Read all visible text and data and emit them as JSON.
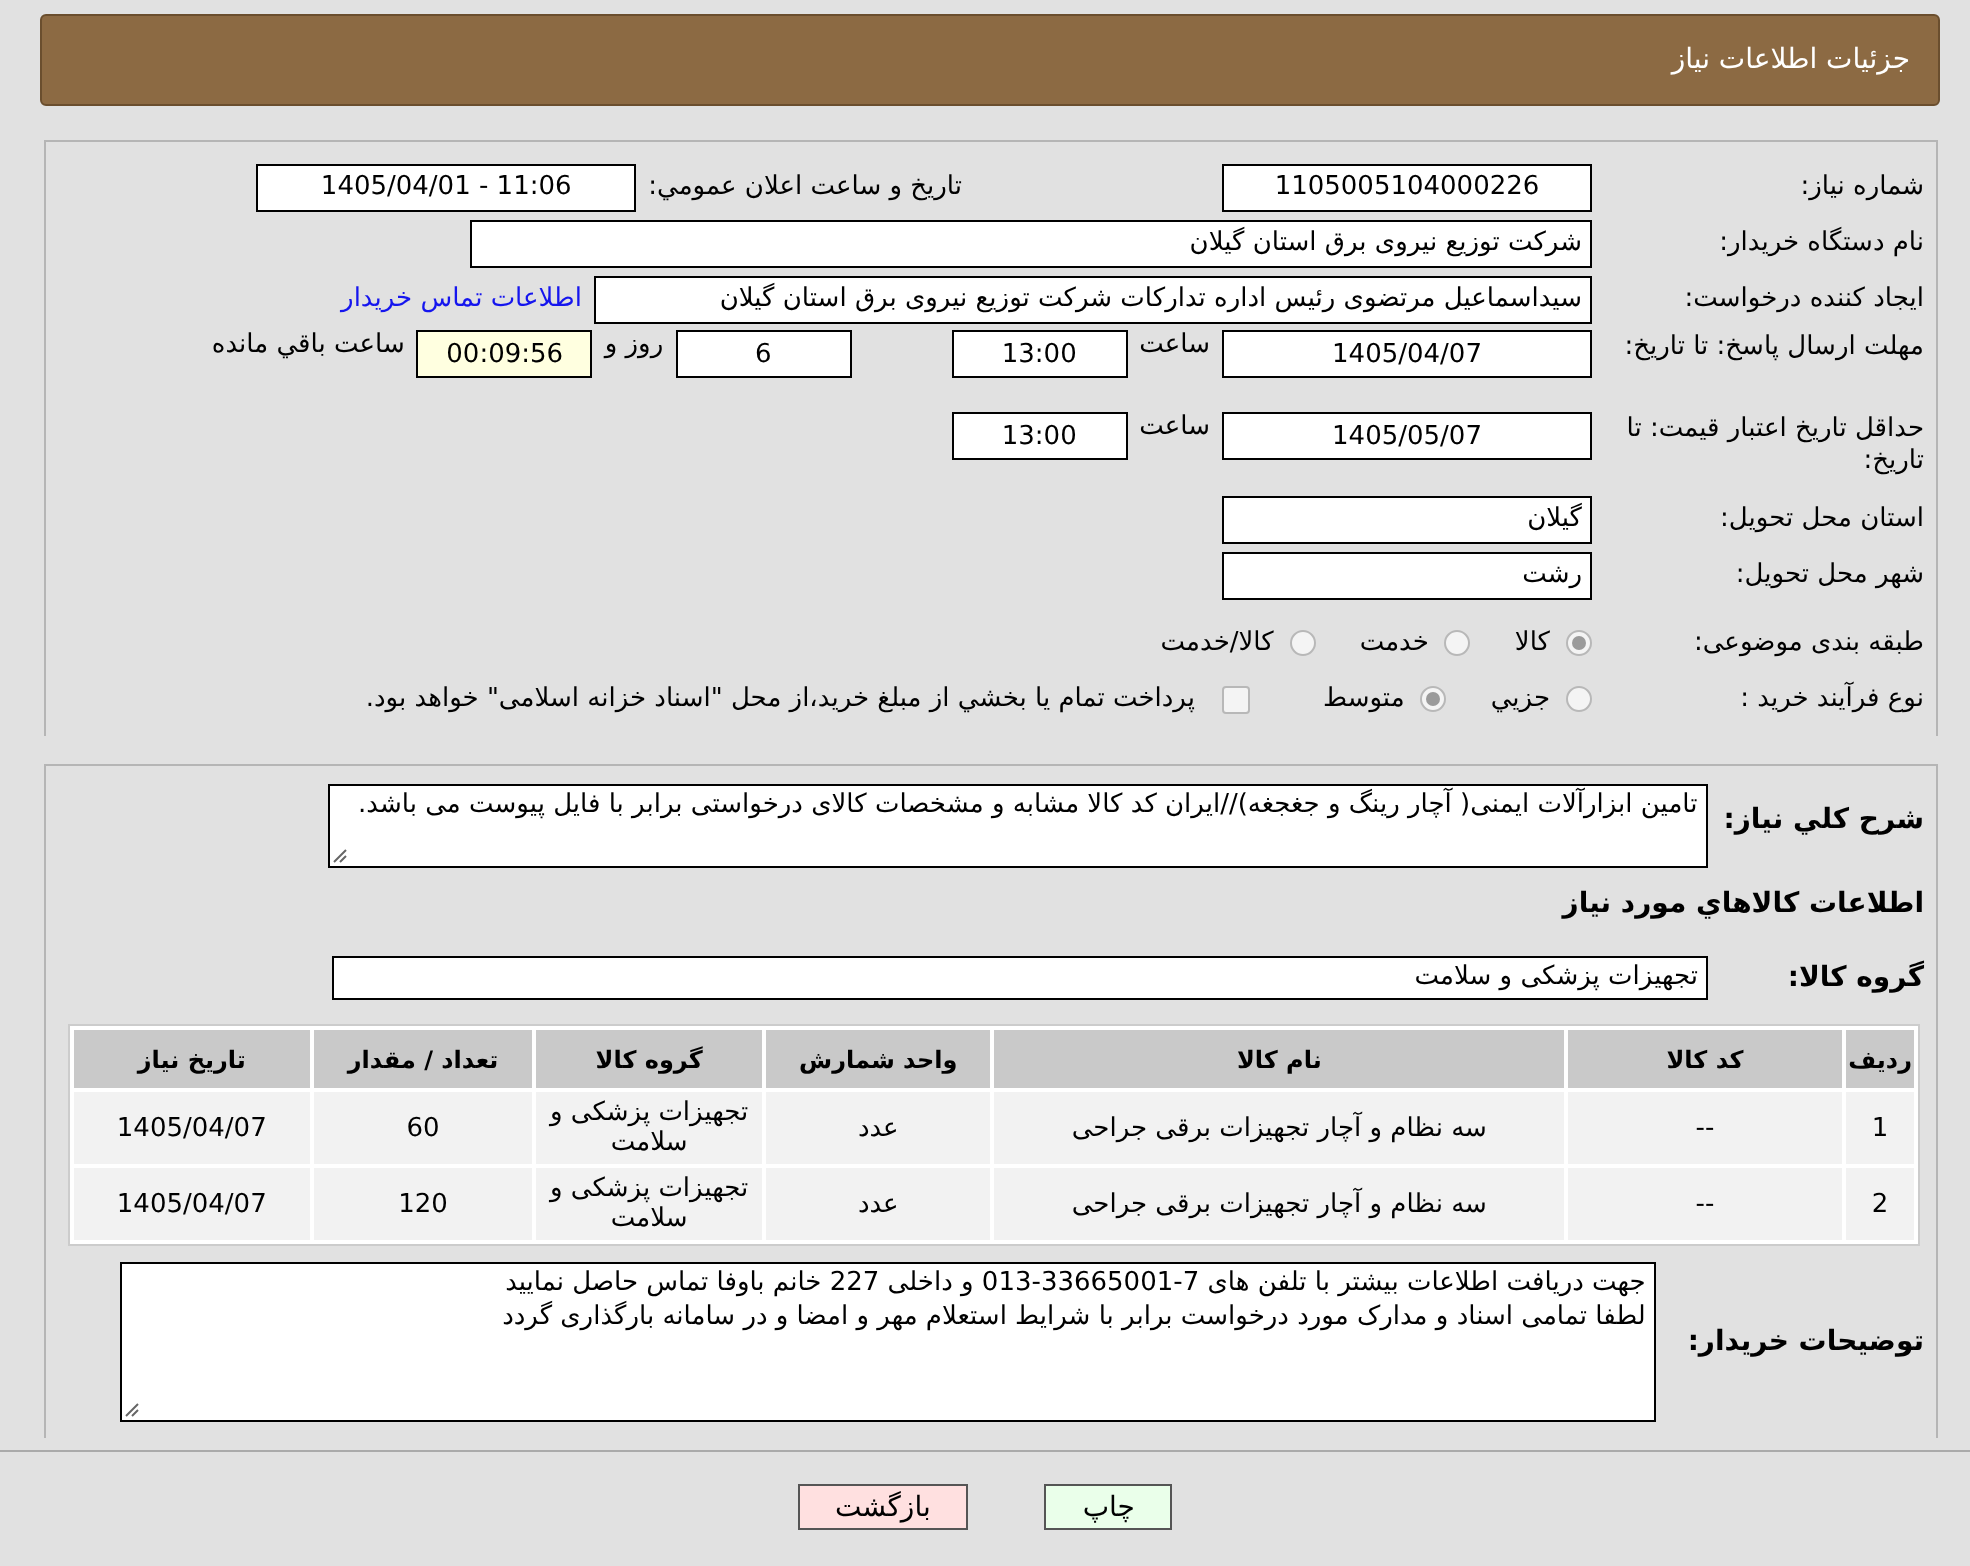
{
  "header": {
    "title": "جزئیات اطلاعات نیاز"
  },
  "details": {
    "need_number": {
      "label": "شماره نیاز:",
      "value": "1105005104000226"
    },
    "announce": {
      "label": "تاريخ و ساعت اعلان عمومي:",
      "value": "1405/04/01 - 11:06"
    },
    "buyer_org": {
      "label": "نام دستگاه خریدار:",
      "value": "شرکت توزیع نیروی برق استان گیلان"
    },
    "requester": {
      "label": "ایجاد کننده درخواست:",
      "value": "سیداسماعیل مرتضوی رئیس اداره تدارکات شرکت توزیع نیروی برق استان گیلان",
      "link": "اطلاعات تماس خريدار"
    },
    "reply_deadline": {
      "label": "مهلت ارسال پاسخ: تا تاریخ:",
      "date": "1405/04/07",
      "time_label": "ساعت",
      "time": "13:00",
      "days": "6",
      "days_label": "روز و",
      "remaining": "00:09:56",
      "remaining_label": "ساعت باقي مانده"
    },
    "price_validity": {
      "label": "حداقل تاریخ اعتبار قیمت: تا تاریخ:",
      "date": "1405/05/07",
      "time_label": "ساعت",
      "time": "13:00"
    },
    "province": {
      "label": "استان محل تحویل:",
      "value": "گیلان"
    },
    "city": {
      "label": "شهر محل تحویل:",
      "value": "رشت"
    },
    "category": {
      "label": "طبقه بندی موضوعی:",
      "options": [
        {
          "label": "کالا",
          "selected": true
        },
        {
          "label": "خدمت",
          "selected": false
        },
        {
          "label": "کالا/خدمت",
          "selected": false
        }
      ]
    },
    "process": {
      "label": "نوع فرآیند خرید :",
      "options": [
        {
          "label": "جزيي",
          "selected": false
        },
        {
          "label": "متوسط",
          "selected": true
        }
      ],
      "treasury": {
        "checked": false,
        "text": "پرداخت تمام يا بخشي از مبلغ خريد،از محل \"اسناد خزانه اسلامی\" خواهد بود."
      }
    }
  },
  "need": {
    "description": {
      "label": "شرح کلي نياز:",
      "value": "تامین ابزارآلات ایمنی( آچار رینگ و جغجغه)//ایران کد کالا مشابه و مشخصات کالای درخواستی برابر با فایل پیوست می باشد."
    },
    "goods_heading": "اطلاعات کالاهاي مورد نياز",
    "goods_group": {
      "label": "گروه کالا:",
      "value": "تجهیزات پزشکی و سلامت"
    },
    "table": {
      "columns": [
        "ردیف",
        "کد کالا",
        "نام کالا",
        "واحد شمارش",
        "گروه کالا",
        "تعداد / مقدار",
        "تاریخ نیاز"
      ],
      "rows": [
        [
          "1",
          "--",
          "سه نظام و آچار تجهیزات برقی جراحی",
          "عدد",
          "تجهیزات پزشکی و سلامت",
          "60",
          "1405/04/07"
        ],
        [
          "2",
          "--",
          "سه نظام و آچار تجهیزات برقی جراحی",
          "عدد",
          "تجهیزات پزشکی و سلامت",
          "120",
          "1405/04/07"
        ]
      ]
    },
    "buyer_notes": {
      "label": "توضیحات خریدار:",
      "value": "جهت دریافت اطلاعات بیشتر با تلفن های 7-33665001-013 و داخلی 227 خانم باوفا تماس حاصل نمایید\nلطفا تمامی اسناد و مدارک مورد درخواست برابر با شرایط استعلام مهر و امضا و در سامانه بارگذاری گردد"
    }
  },
  "buttons": [
    {
      "kind": "print",
      "label": "چاپ"
    },
    {
      "kind": "back",
      "label": "بازگشت"
    }
  ]
}
